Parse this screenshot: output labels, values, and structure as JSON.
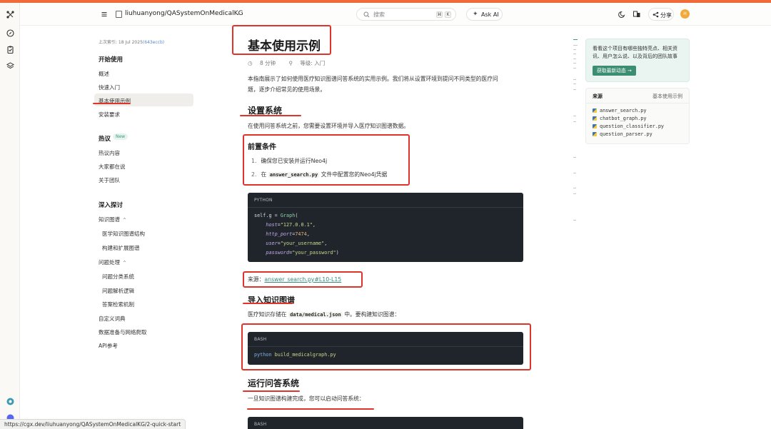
{
  "header": {
    "repo_name": "liuhuanyong/QASystemOnMedicalKG",
    "search_placeholder": "搜索",
    "kbd_cmd": "⌘",
    "kbd_k": "K",
    "ask_ai": "Ask AI",
    "share": "分享",
    "avatar_initial": "H"
  },
  "sidebar": {
    "last_index_label": "上次索引: 18 Jul 2025",
    "last_index_hash": "(643eccb)",
    "section_getting_started": "开始使用",
    "item_overview": "概述",
    "item_quick_start": "快速入门",
    "item_basic_examples": "基本使用示例",
    "item_install": "安装要求",
    "section_hot": "热议",
    "new_badge": "New",
    "item_hot_content": "热议内容",
    "item_everyone": "大家都在说",
    "item_about_team": "关于团队",
    "section_deep_dive": "深入探讨",
    "item_kg": "知识图谱",
    "item_kg_structure": "医学知识图谱结构",
    "item_kg_build": "构建和扩展图谱",
    "item_qp": "问题处理",
    "item_qp_classify": "问题分类系统",
    "item_qp_parse": "问题解析逻辑",
    "item_qp_retrieve": "答案检索机制",
    "item_custom_dict": "自定义词典",
    "item_data_prep": "数据准备与网络爬取",
    "item_api": "API参考"
  },
  "main": {
    "title": "基本使用示例",
    "read_time": "8 分钟",
    "level": "等级: 入门",
    "intro_line1": "本指南展示了如何使用医疗知识图谱问答系统的实用示例。我们将从设置环境到提问不同类型的医疗问",
    "intro_line2": "题，逐步介绍常见的使用场景。",
    "h_setup": "设置系统",
    "setup_desc": "在使用问答系统之前，您需要设置环境并导入医疗知识图谱数据。",
    "h_prereq": "前置条件",
    "prereq_1": "确保您已安装并运行Neo4j",
    "prereq_2_pre": "在",
    "prereq_2_code": "answer_search.py",
    "prereq_2_post": "文件中配置您的Neo4j凭据",
    "code1_lang": "PYTHON",
    "code1_l1_a": "self.g = ",
    "code1_l1_fn": "Graph",
    "code1_l1_b": "(",
    "code1_l2_p": "host",
    "code1_l2_v": "\"127.0.0.1\"",
    "code1_l3_p": "http_port",
    "code1_l3_v": "7474",
    "code1_l4_p": "user",
    "code1_l4_v": "\"your_username\"",
    "code1_l5_p": "password",
    "code1_l5_v": "\"your_password\"",
    "source_label": "来源：",
    "source_link": "answer_search.py#L10-L15",
    "h_import": "导入知识图谱",
    "import_desc_pre": "医疗知识存储在",
    "import_desc_code": "data/medical.json",
    "import_desc_post": "中。要构建知识图谱：",
    "code2_lang": "BASH",
    "code2_cmd": "python",
    "code2_arg": "build_medicalgraph.py",
    "h_run": "运行问答系统",
    "run_desc": "一旦知识图谱构建完成，您可以启动问答系统：",
    "code3_lang": "BASH"
  },
  "right_panel": {
    "promo_text": "看看这个项目有哪些独特亮点、相关资讯、用户怎么说、以及背后的团队故事",
    "promo_button": "获取最新动态 →",
    "sources_title": "来源",
    "sources_page": "基本使用示例",
    "source_files": [
      "answer_search.py",
      "chatbot_graph.py",
      "question_classifier.py",
      "question_parser.py"
    ]
  },
  "status_url": "https://cgx.dev/liuhuanyong/QASystemOnMedicalKG/2-quick-start",
  "colors": {
    "accent": "#f06a3a",
    "annotation_red": "#e0342b",
    "link_green": "#3a8a7a",
    "code_bg": "#20252c"
  }
}
